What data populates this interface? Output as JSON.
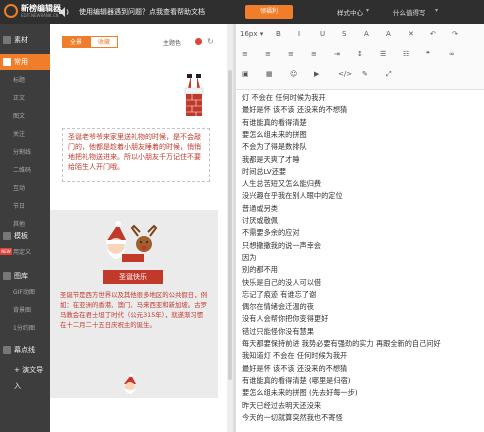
{
  "topbar": {
    "logo_title": "新榜编辑器",
    "logo_sub": "EDIT.NEWRANK.CN",
    "notice": "使用编辑器遇到问题？点我查看帮助文档",
    "gift_button": "领福利",
    "links": [
      "样式中心",
      "什么值得写"
    ]
  },
  "nav": {
    "main": [
      {
        "label": "素材",
        "active": false
      },
      {
        "label": "常用",
        "active": true
      },
      {
        "label": "模板",
        "active": false
      },
      {
        "label": "图库",
        "active": false
      },
      {
        "label": "幕点线",
        "active": false
      },
      {
        "label": "+ 演文导入",
        "active": false
      }
    ],
    "sub_common": [
      "标题",
      "正文",
      "图文",
      "关注",
      "分割线",
      "二维码",
      "互动",
      "节日",
      "其他"
    ],
    "sub_template": [
      "用定义"
    ],
    "sub_gallery": [
      "GIF动图",
      "背景图",
      "1分约图"
    ],
    "new_badge": "NEW"
  },
  "template": {
    "tabs": [
      "全景",
      "收藏"
    ],
    "theme_label": "主题色",
    "card1_text": "圣诞老爷爷来家里送礼物的时候，是不会敲门的，他都是趁着小朋友睡着的时候，悄悄地把礼物送进来。所以小朋友千万记住不要给陌生人开门哦。",
    "badge": "圣诞快乐",
    "card2_text": "圣诞节是西方世界以及其他很多地区的公共假日，例如：在亚洲的香港、澳门、马来西亚和新加坡。古罗马教会在君士坦丁时代（公元315年），就遂渐习惯在十二月二十五日庆祝主的诞生。"
  },
  "toolbar": {
    "font_size": "16px",
    "row1_icons": [
      "bold-icon",
      "italic-icon",
      "underline-icon",
      "strikethrough-icon",
      "font-color-icon",
      "highlight-icon",
      "clear-format-icon",
      "undo-icon",
      "redo-icon"
    ],
    "row2_icons": [
      "align-left-icon",
      "align-center-icon",
      "align-right-icon",
      "justify-icon",
      "indent-icon",
      "line-height-icon",
      "list-icon",
      "ordered-list-icon",
      "quote-icon",
      "link-icon"
    ],
    "row3_icons": [
      "image-icon",
      "table-icon",
      "emoji-icon",
      "video-icon",
      "code-icon",
      "format-brush-icon",
      "fullscreen-icon"
    ]
  },
  "editor": {
    "lines": [
      "灯 不会在 任何时候为我开",
      "最好是怀 该不该 还没来的不想猜",
      "有谁能真的看得清楚",
      "要怎么组未来的拼图",
      "不会为了得是数排队",
      "我都是天爽了才睡",
      "时间总LV还要",
      "人生总苦短又怎么能归费",
      "没兴趣在乎我在别人眼中的定位",
      "普通或另类",
      "讨厌或敬佩",
      "不需要多余的应对",
      "只想撒撒我的说一声幸会",
      "因为",
      "别的都不用",
      "快乐是自己的没人可以借",
      "忘记了痕迹 有谁忘了谢",
      "偶尔在情绪会迁温的夜",
      "没有人会帮你把你变得更好",
      "错过只能怪你没有慧果",
      "每天都要保持前进 我势必要有强劲的实力 再跟全新的自己问好",
      "我知道灯 不会在 任何时候为我开",
      "最好是怀 该不该 还没来的不想猜",
      "有谁能真的看得清楚 (哪里是归宿)",
      "要怎么组未来的拼图 (先去好每一步)",
      "昨天已经过去明天还没来",
      "今天的一切就算突然我也不寄怪"
    ]
  }
}
